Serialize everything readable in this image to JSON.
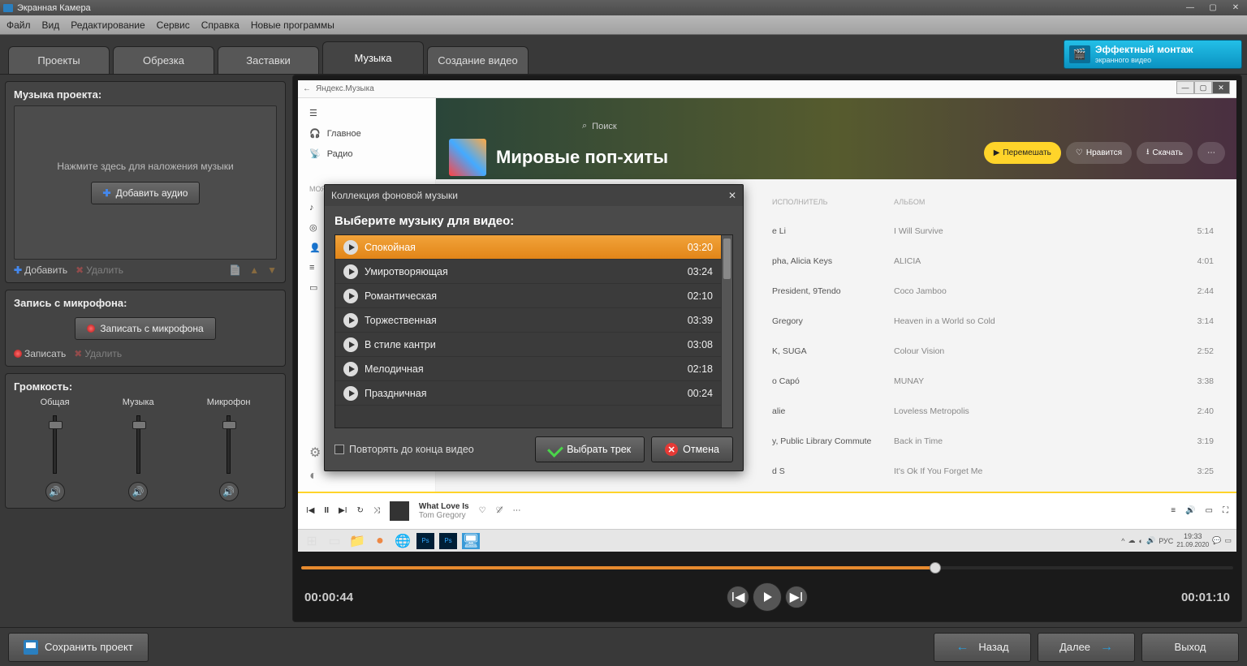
{
  "app_title": "Экранная Камера",
  "menu": [
    "Файл",
    "Вид",
    "Редактирование",
    "Сервис",
    "Справка",
    "Новые программы"
  ],
  "tabs": [
    "Проекты",
    "Обрезка",
    "Заставки",
    "Музыка",
    "Создание видео"
  ],
  "active_tab": 3,
  "promo": {
    "line1": "Эффектный монтаж",
    "line2": "экранного видео"
  },
  "sidebar": {
    "music_title": "Музыка проекта:",
    "drop_hint": "Нажмите здесь для наложения музыки",
    "add_audio": "Добавить аудио",
    "add": "Добавить",
    "delete": "Удалить",
    "mic_title": "Запись с микрофона:",
    "record_mic": "Записать с микрофона",
    "record": "Записать",
    "volume_title": "Громкость:",
    "volume": {
      "total": "Общая",
      "music": "Музыка",
      "mic": "Микрофон"
    }
  },
  "preview": {
    "yx_app": "Яндекс.Музыка",
    "yx_search": "Поиск",
    "yx_nav": {
      "main": "Главное",
      "radio": "Радио",
      "mymusic": "МОЯ МУЗЫКА"
    },
    "page_title": "Мировые поп-хиты",
    "btn_shuffle": "Перемешать",
    "btn_like": "Нравится",
    "btn_download": "Скачать",
    "col_artist": "ИСПОЛНИТЕЛЬ",
    "col_album": "АЛЬБОМ",
    "rows": [
      {
        "artist": "e Li",
        "album": "I Will Survive",
        "dur": "5:14"
      },
      {
        "artist": "pha, Alicia Keys",
        "album": "ALICIA",
        "dur": "4:01"
      },
      {
        "artist": "President, 9Tendo",
        "album": "Coco Jamboo",
        "dur": "2:44"
      },
      {
        "artist": "Gregory",
        "album": "Heaven in a World so Cold",
        "dur": "3:14"
      },
      {
        "artist": "K, SUGA",
        "album": "Colour Vision",
        "dur": "2:52"
      },
      {
        "artist": "o Capó",
        "album": "MUNAY",
        "dur": "3:38"
      },
      {
        "artist": "alie",
        "album": "Loveless Metropolis",
        "dur": "2:40"
      },
      {
        "artist": "y, Public Library Commute",
        "album": "Back in Time",
        "dur": "3:19"
      },
      {
        "artist": "d S",
        "album": "It's Ok If You Forget Me",
        "dur": "3:25"
      }
    ],
    "now_playing": {
      "title": "What Love Is",
      "artist": "Tom Gregory"
    },
    "task_time": "19:33",
    "task_date": "21.09.2020",
    "task_lang": "РУС"
  },
  "modal": {
    "title": "Коллекция фоновой музыки",
    "heading": "Выберите музыку для видео:",
    "tracks": [
      {
        "name": "Спокойная",
        "dur": "03:20"
      },
      {
        "name": "Умиротворяющая",
        "dur": "03:24"
      },
      {
        "name": "Романтическая",
        "dur": "02:10"
      },
      {
        "name": "Торжественная",
        "dur": "03:39"
      },
      {
        "name": "В стиле кантри",
        "dur": "03:08"
      },
      {
        "name": "Мелодичная",
        "dur": "02:18"
      },
      {
        "name": "Праздничная",
        "dur": "00:24"
      }
    ],
    "selected": 0,
    "repeat": "Повторять до конца видео",
    "ok": "Выбрать трек",
    "cancel": "Отмена"
  },
  "timeline": {
    "current": "00:00:44",
    "total": "00:01:10"
  },
  "bottom": {
    "save": "Сохранить проект",
    "back": "Назад",
    "next": "Далее",
    "exit": "Выход"
  }
}
